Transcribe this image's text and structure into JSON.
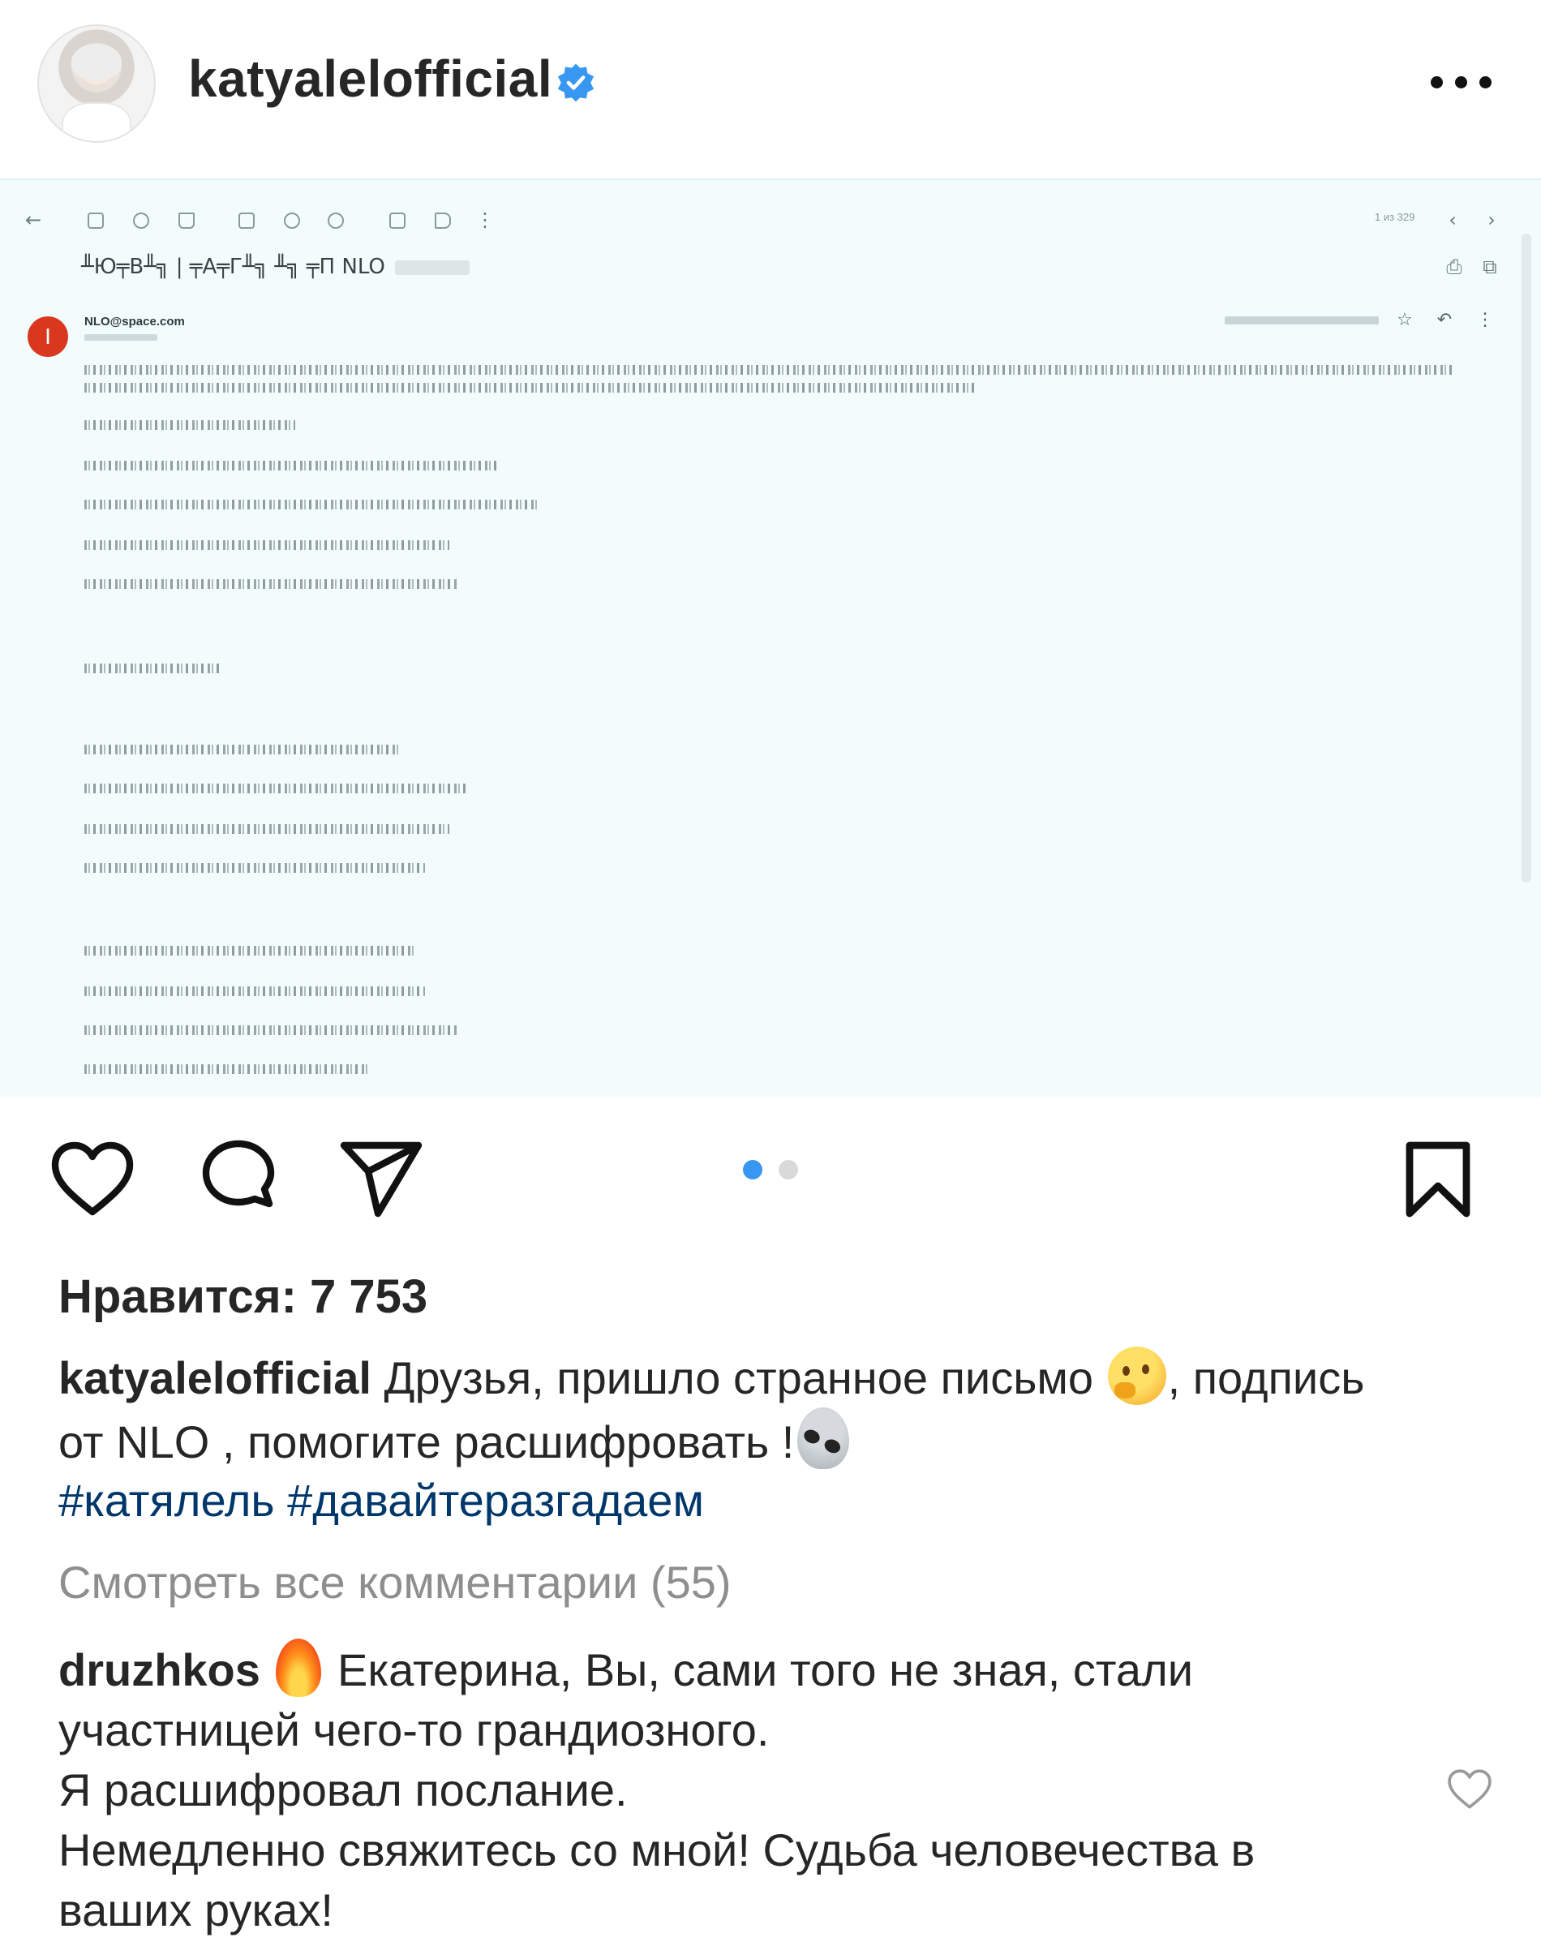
{
  "post": {
    "username": "katyalelofficial",
    "verified": true,
    "more_icon": "more-horizontal-icon"
  },
  "media": {
    "type": "email-screenshot",
    "page_count": "1 из 329",
    "subject": "╨Ю╤В╨╗ | ╤А╤Г╨╗ ╨╗ ╤П NLO",
    "sender_initial": "I",
    "sender": "NLO@space.com"
  },
  "actions": {
    "like_icon": "heart-icon",
    "comment_icon": "comment-icon",
    "share_icon": "send-icon",
    "save_icon": "bookmark-icon",
    "carousel_total": 2,
    "carousel_active": 1,
    "active_dot_color": "#3897f0",
    "inactive_dot_color": "#d9d9d9"
  },
  "likes": {
    "text": "Нравится: 7 753"
  },
  "caption": {
    "user": "katyalelofficial",
    "text_part1": " Друзья, пришло странное письмо ",
    "text_part2": ", подпись  от NLO , помогите расшифровать !",
    "emoji_1": "thinking-face",
    "emoji_2": "alien",
    "hashtags": "#катялель #давайтеразгадаем"
  },
  "comments": {
    "view_all": "Смотреть все комментарии (55)",
    "items": [
      {
        "user": "druzhkos",
        "emoji": "fire",
        "line1": " Екатерина, Вы, сами того не зная, стали участницей чего-то грандиозного.",
        "line2": "Я расшифровал послание.",
        "line3": "Немедленно свяжитесь со мной! Судьба человечества в ваших руках!"
      }
    ]
  },
  "colors": {
    "text": "#262626",
    "muted": "#8e8e8e",
    "hashtag": "#00376b",
    "verified": "#3897f0",
    "media_bg": "#f2fcfd"
  }
}
